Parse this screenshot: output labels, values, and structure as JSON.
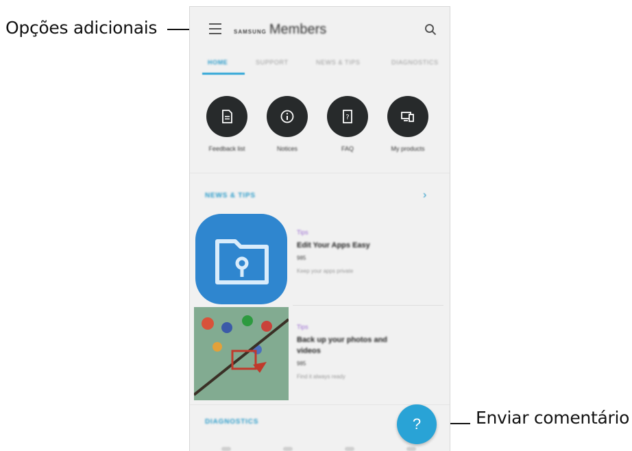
{
  "callouts": {
    "more_options": "Opções adicionais",
    "send_feedback": "Enviar comentário"
  },
  "app": {
    "brand_samsung": "SAMSUNG",
    "brand_members": "Members",
    "menu_icon": "hamburger-menu-icon",
    "search_icon": "search-icon"
  },
  "tabs": [
    "HOME",
    "SUPPORT",
    "NEWS & TIPS",
    "DIAGNOSTICS"
  ],
  "quick_actions": [
    {
      "label": "Feedback list",
      "icon": "document-icon"
    },
    {
      "label": "Notices",
      "icon": "info-icon"
    },
    {
      "label": "FAQ",
      "icon": "faq-icon"
    },
    {
      "label": "My products",
      "icon": "devices-icon"
    }
  ],
  "news_section": {
    "title": "NEWS & TIPS"
  },
  "articles": [
    {
      "tag": "Tips",
      "title": "Edit Your Apps Easy",
      "sub": "985",
      "desc": "Keep your apps private"
    },
    {
      "tag": "Tips",
      "title": "Back up your photos and videos",
      "sub": "985",
      "desc": "Find it always ready"
    }
  ],
  "diagnostics_section": {
    "title": "DIAGNOSTICS"
  },
  "fab": {
    "label": "?"
  },
  "colors": {
    "accent": "#29a3d6",
    "icon_circle": "#272a2b",
    "tag": "#9b6cd1"
  }
}
